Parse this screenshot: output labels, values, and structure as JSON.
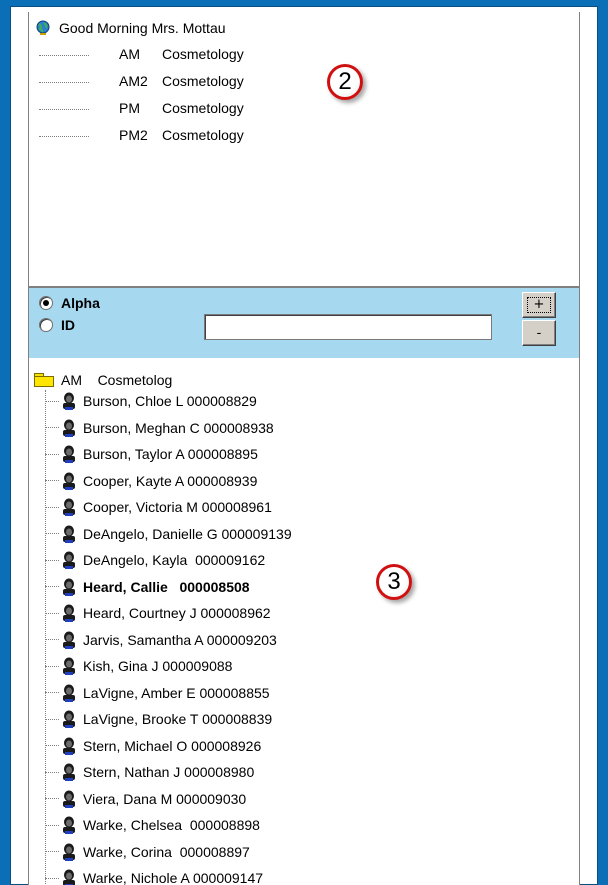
{
  "greeting": "Good Morning Mrs. Mottau",
  "levels": [
    {
      "code": "AM",
      "name": "Cosmetology"
    },
    {
      "code": "AM2",
      "name": "Cosmetology"
    },
    {
      "code": "PM",
      "name": "Cosmetology"
    },
    {
      "code": "PM2",
      "name": "Cosmetology"
    }
  ],
  "callouts": {
    "top": "2",
    "bottom": "3"
  },
  "search": {
    "options": [
      {
        "label": "Alpha",
        "selected": true
      },
      {
        "label": "ID",
        "selected": false
      }
    ],
    "value": "",
    "plus_label": "+",
    "minus_label": "-"
  },
  "group": {
    "code": "AM",
    "name": "Cosmetolog"
  },
  "students": [
    {
      "label": "Burson, Chloe L 000008829",
      "selected": false
    },
    {
      "label": "Burson, Meghan C 000008938",
      "selected": false
    },
    {
      "label": "Burson, Taylor A 000008895",
      "selected": false
    },
    {
      "label": "Cooper, Kayte A 000008939",
      "selected": false
    },
    {
      "label": "Cooper, Victoria M 000008961",
      "selected": false
    },
    {
      "label": "DeAngelo, Danielle G 000009139",
      "selected": false
    },
    {
      "label": "DeAngelo, Kayla  000009162",
      "selected": false
    },
    {
      "label": "Heard, Callie   000008508",
      "selected": true
    },
    {
      "label": "Heard, Courtney J 000008962",
      "selected": false
    },
    {
      "label": "Jarvis, Samantha A 000009203",
      "selected": false
    },
    {
      "label": "Kish, Gina J 000009088",
      "selected": false
    },
    {
      "label": "LaVigne, Amber E 000008855",
      "selected": false
    },
    {
      "label": "LaVigne, Brooke T 000008839",
      "selected": false
    },
    {
      "label": "Stern, Michael O 000008926",
      "selected": false
    },
    {
      "label": "Stern, Nathan J 000008980",
      "selected": false
    },
    {
      "label": "Viera, Dana M 000009030",
      "selected": false
    },
    {
      "label": "Warke, Chelsea  000008898",
      "selected": false
    },
    {
      "label": "Warke, Corina  000008897",
      "selected": false
    },
    {
      "label": "Warke, Nichole A 000009147",
      "selected": false
    }
  ],
  "colors": {
    "frame": "#0a6fb7",
    "search_bar": "#a6d8f0",
    "folder": "#ffe600",
    "callout_ring": "#d01010"
  },
  "icons": {
    "greeting": "globe-icon",
    "group": "folder-icon",
    "student": "person-icon"
  }
}
